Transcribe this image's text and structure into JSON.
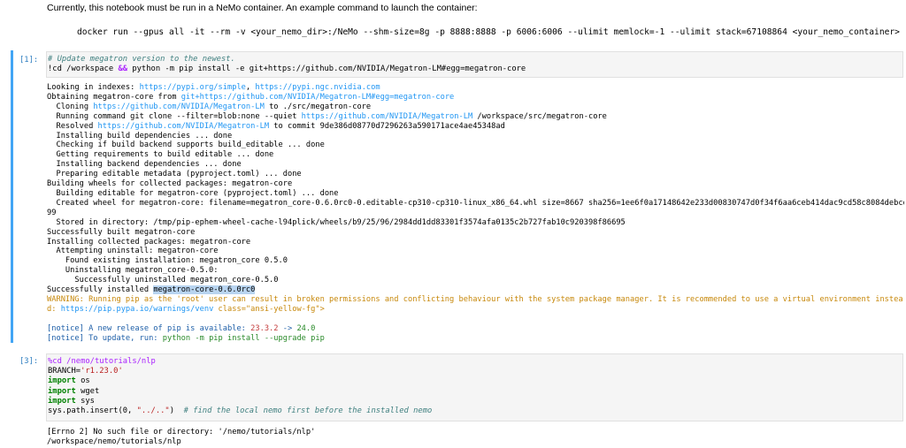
{
  "markdown": {
    "intro": "Currently, this notebook must be run in a NeMo container. An example command to launch the container:",
    "command": "docker run --gpus all -it --rm -v <your_nemo_dir>:/NeMo --shm-size=8g -p 8888:8888 -p 6006:6006 --ulimit memlock=-1 --ulimit stack=67108864 <your_nemo_container>"
  },
  "cells": [
    {
      "prompt": "[1]:",
      "comment": "# Update megatron version to the newest.",
      "cmd_prefix": "!cd /workspace",
      "cmd_op": "&&",
      "cmd_mid": " python -m pip install -e git+https:",
      "cmd_url": "//github.com/NVIDIA/Megatron-LM#egg=megatron-core",
      "output": {
        "l1a": "Looking in indexes: ",
        "l1b": "https://pypi.org/simple",
        "l1c": ", ",
        "l1d": "https://pypi.ngc.nvidia.com",
        "l2a": "Obtaining megatron-core from ",
        "l2b": "git+https://github.com/NVIDIA/Megatron-LM#egg=megatron-core",
        "l3a": "  Cloning ",
        "l3b": "https://github.com/NVIDIA/Megatron-LM",
        "l3c": " to ./src/megatron-core",
        "l4a": "  Running command git clone --filter=blob:none --quiet ",
        "l4b": "https://github.com/NVIDIA/Megatron-LM",
        "l4c": " /workspace/src/megatron-core",
        "l5a": "  Resolved ",
        "l5b": "https://github.com/NVIDIA/Megatron-LM",
        "l5c": " to commit 9de386d08770d7296263a590171ace4ae45348ad",
        "l6": "  Installing build dependencies ... done",
        "l7": "  Checking if build backend supports build_editable ... done",
        "l8": "  Getting requirements to build editable ... done",
        "l9": "  Installing backend dependencies ... done",
        "l10": "  Preparing editable metadata (pyproject.toml) ... done",
        "l11": "Building wheels for collected packages: megatron-core",
        "l12": "  Building editable for megatron-core (pyproject.toml) ... done",
        "l13": "  Created wheel for megatron-core: filename=megatron_core-0.6.0rc0-0.editable-cp310-cp310-linux_x86_64.whl size=8667 sha256=1ee6f0a17148642e233d00830747d0f34f6aa6ceb414dac9cd58c8084debcd",
        "l14": "99",
        "l15": "  Stored in directory: /tmp/pip-ephem-wheel-cache-l94plick/wheels/b9/25/96/2984dd1dd83301f3574afa0135c2b727fab10c920398f86695",
        "l16": "Successfully built megatron-core",
        "l17": "Installing collected packages: megatron-core",
        "l18": "  Attempting uninstall: megatron-core",
        "l19": "    Found existing installation: megatron_core 0.5.0",
        "l20": "    Uninstalling megatron_core-0.5.0:",
        "l21": "      Successfully uninstalled megatron_core-0.5.0",
        "l22a": "Successfully installed ",
        "l22b": "megatron-core-0.6.0rc0",
        "l23": "WARNING: Running pip as the 'root' user can result in broken permissions and conflicting behaviour with the system package manager. It is recommended to use a virtual environment instea",
        "l24a": "d: ",
        "l24b": "https://pip.pypa.io/warnings/venv",
        "l24c": " class=\"ansi-yellow-fg\">",
        "l25a": "[notice]",
        "l25b": " A new release of pip is available: ",
        "l25c": "23.3.2",
        "l25d": " -> ",
        "l25e": "24.0",
        "l26a": "[notice]",
        "l26b": " To update, run: ",
        "l26c": "python -m pip install --upgrade pip"
      }
    },
    {
      "prompt": "[3]:",
      "line1": "%cd /nemo/tutorials/nlp",
      "line2a": "BRANCH=",
      "line2b": "'r1.23.0'",
      "line3a": "import",
      "line3b": " os",
      "line4a": "import",
      "line4b": " wget",
      "line5a": "import",
      "line5b": " sys",
      "line6a": "sys.path.insert(0, ",
      "line6b": "\"../..\"",
      "line6c": ")  ",
      "line6d": "# find the local nemo first before the installed nemo",
      "output1": "[Errno 2] No such file or directory: '/nemo/tutorials/nlp'",
      "output2": "/workspace/nemo/tutorials/nlp"
    }
  ]
}
